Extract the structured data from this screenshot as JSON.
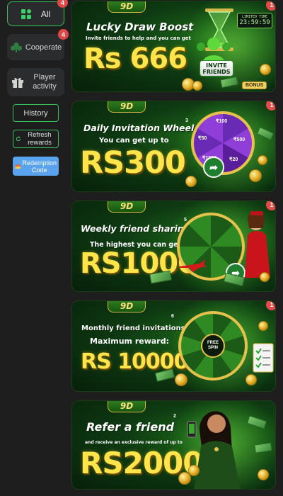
{
  "sidebar": {
    "tabs": [
      {
        "label": "All",
        "badge": "4",
        "icon": "grid-icon",
        "active": true
      },
      {
        "label": "Cooperate",
        "badge": "4",
        "icon": "club-icon"
      },
      {
        "label": "Player activity",
        "icon": "gift-icon"
      }
    ],
    "history_label": "History",
    "refresh_label": "Refresh rewards",
    "redeem_label": "Redemption Code"
  },
  "colors": {
    "accent": "#36c25a",
    "badge": "#e04848",
    "redeem": "#5aa4ef",
    "amount": "#ffe44a"
  },
  "banners": [
    {
      "logo": "9D",
      "badge": "1",
      "title": "Lucky Draw Boost",
      "subtitle": "Invite friends to help and you can get",
      "amount": "Rs 666",
      "timer_label": "LIMITED TIME",
      "timer_value": "23:59:59",
      "pill": "INVITE FRIENDS",
      "bonus": "BONUS"
    },
    {
      "logo": "9D",
      "badge": "1",
      "title": "Daily Invitation Wheel",
      "marker": "3",
      "subtitle": "You can get up to",
      "amount": "RS300",
      "wheel_values": [
        "₹100",
        "₹50",
        "₹500",
        "₹1000",
        "₹20"
      ]
    },
    {
      "logo": "9D",
      "badge": "1",
      "title": "Weekly friend sharing",
      "marker": "5",
      "subtitle": "The highest you can get is",
      "amount": "RS1000"
    },
    {
      "logo": "9D",
      "badge": "1",
      "title": "Monthly friend invitations",
      "marker": "6",
      "subtitle": "Maximum reward:",
      "amount": "RS 10000",
      "spin_label": "FREE SPIN"
    },
    {
      "logo": "9D",
      "title": "Refer a friend",
      "marker": "2",
      "subtitle": "and receive an exclusive reward of up to",
      "amount": "RS2000"
    }
  ]
}
